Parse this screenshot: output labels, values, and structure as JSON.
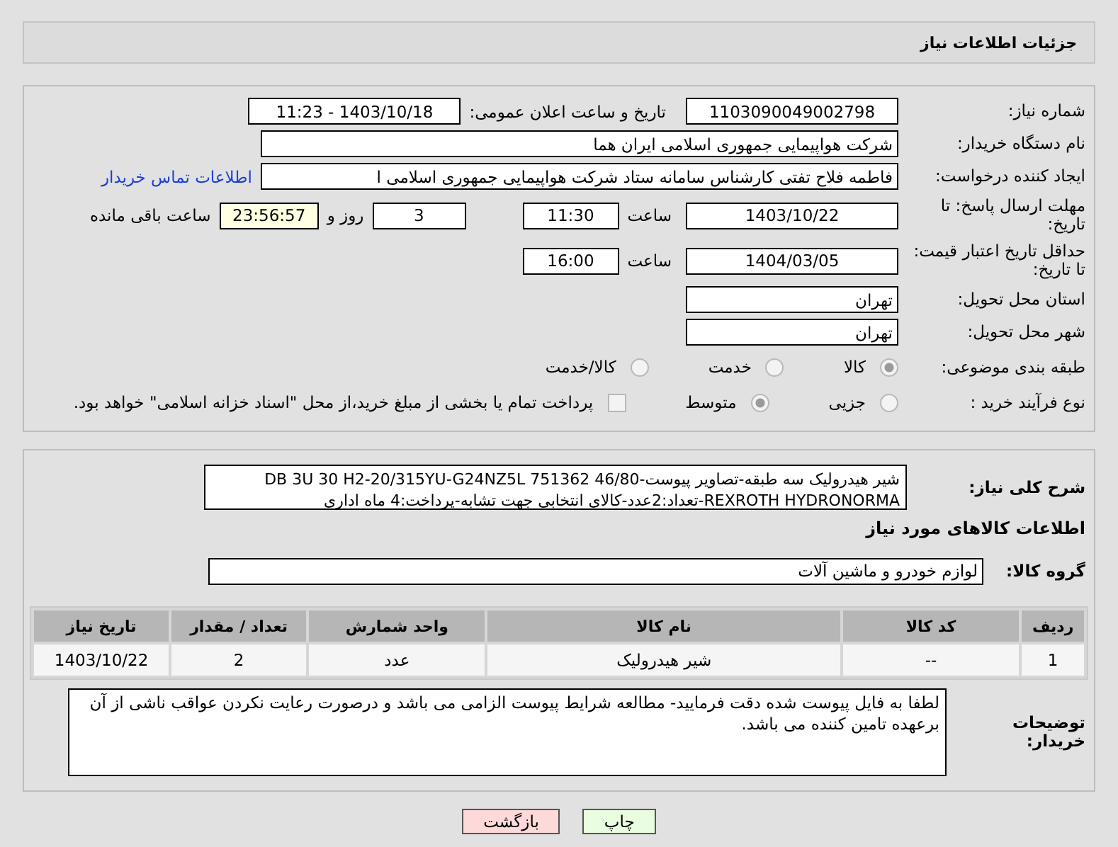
{
  "header": {
    "title": "جزئیات اطلاعات نیاز"
  },
  "need_number": {
    "label": "شماره نیاز:",
    "value": "1103090049002798"
  },
  "announce": {
    "label": "تاریخ و ساعت اعلان عمومی:",
    "value": "1403/10/18 - 11:23"
  },
  "buyer": {
    "label": "نام دستگاه خریدار:",
    "value": "شرکت هواپیمایی جمهوری اسلامی ایران هما"
  },
  "creator": {
    "label": "ایجاد کننده درخواست:",
    "value": "فاطمه فلاح تفتی کارشناس سامانه ستاد شرکت هواپیمایی جمهوری اسلامی ا",
    "link": "اطلاعات تماس خریدار"
  },
  "deadline": {
    "label": "مهلت ارسال پاسخ: تا تاریخ:",
    "date": "1403/10/22",
    "time_label": "ساعت",
    "time": "11:30",
    "days": "3",
    "days_label": "روز و",
    "remaining": "23:56:57",
    "remaining_label": "ساعت باقی مانده"
  },
  "validity": {
    "label": "حداقل تاریخ اعتبار قیمت: تا تاریخ:",
    "date": "1404/03/05",
    "time_label": "ساعت",
    "time": "16:00"
  },
  "province": {
    "label": "استان محل تحویل:",
    "value": "تهران"
  },
  "city": {
    "label": "شهر محل تحویل:",
    "value": "تهران"
  },
  "category": {
    "label": "طبقه بندی موضوعی:",
    "options": [
      {
        "label": "کالا",
        "selected": true
      },
      {
        "label": "خدمت",
        "selected": false
      },
      {
        "label": "کالا/خدمت",
        "selected": false
      }
    ]
  },
  "process": {
    "label": "نوع فرآیند خرید :",
    "options": [
      {
        "label": "جزیی",
        "selected": false
      },
      {
        "label": "متوسط",
        "selected": true
      }
    ],
    "payment": {
      "checked": false,
      "label": "پرداخت تمام یا بخشی از مبلغ خرید،از محل \"اسناد خزانه اسلامی\" خواهد بود."
    }
  },
  "description": {
    "label": "شرح کلی نیاز:",
    "value": "شیر هیدرولیک سه طبقه-تصاویر پیوست-DB 3U 30 H2-20/315YU-G24NZ5L 751362 46/80 REXROTH HYDRONORMA-تعداد:2عدد-کالای انتخابی جهت تشابه-پرداخت:4 ماه اداری"
  },
  "goods_title": "اطلاعات کالاهای مورد نیاز",
  "group": {
    "label": "گروه کالا:",
    "value": "لوازم خودرو و ماشین آلات"
  },
  "table": {
    "columns": [
      "ردیف",
      "کد کالا",
      "نام کالا",
      "واحد شمارش",
      "تعداد / مقدار",
      "تاریخ نیاز"
    ],
    "rows": [
      [
        "1",
        "--",
        "شیر هیدرولیک",
        "عدد",
        "2",
        "1403/10/22"
      ]
    ]
  },
  "notes": {
    "label": "توضیحات خریدار:",
    "value": "لطفا به فایل پیوست شده دقت فرمایید- مطالعه شرایط پیوست الزامی می باشد و درصورت رعایت نکردن عواقب ناشی از آن برعهده تامین کننده می باشد."
  },
  "buttons": [
    {
      "label": "چاپ",
      "kind": "print"
    },
    {
      "label": "بازگشت",
      "kind": "back"
    }
  ]
}
